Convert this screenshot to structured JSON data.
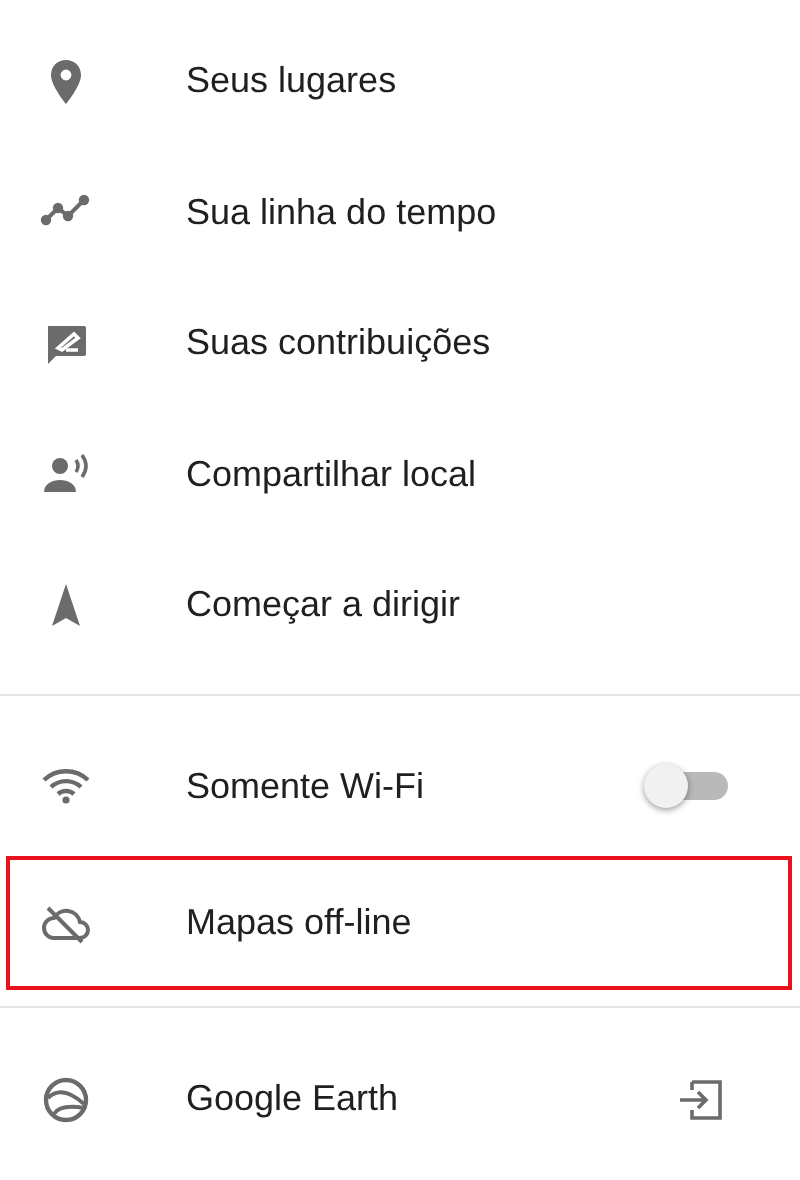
{
  "sections": [
    {
      "items": [
        {
          "kind": "places",
          "label": "Seus lugares"
        },
        {
          "kind": "timeline",
          "label": "Sua linha do tempo"
        },
        {
          "kind": "contributions",
          "label": "Suas contribuições"
        },
        {
          "kind": "share",
          "label": "Compartilhar local"
        },
        {
          "kind": "drive",
          "label": "Começar a dirigir"
        }
      ]
    },
    {
      "items": [
        {
          "kind": "wifi",
          "label": "Somente Wi-Fi",
          "on": false
        },
        {
          "kind": "offline",
          "label": "Mapas off-line",
          "highlighted": true
        }
      ]
    },
    {
      "items": [
        {
          "kind": "earth",
          "label": "Google Earth"
        }
      ]
    }
  ]
}
